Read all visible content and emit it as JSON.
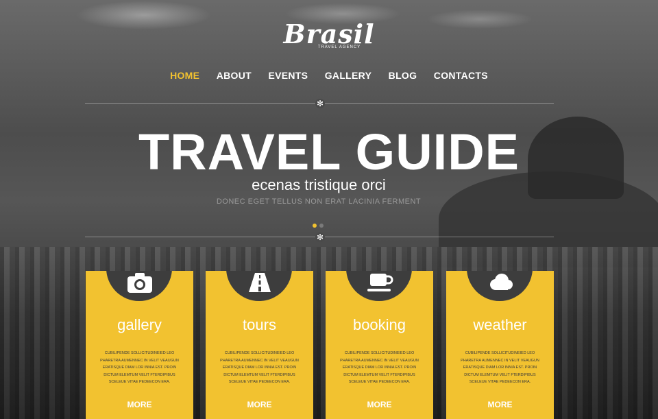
{
  "logo": {
    "title": "Brasil",
    "subtitle": "TRAVEL AGENCY"
  },
  "nav": {
    "items": [
      {
        "label": "HOME",
        "active": true
      },
      {
        "label": "ABOUT",
        "active": false
      },
      {
        "label": "EVENTS",
        "active": false
      },
      {
        "label": "GALLERY",
        "active": false
      },
      {
        "label": "BLOG",
        "active": false
      },
      {
        "label": "CONTACTS",
        "active": false
      }
    ]
  },
  "divider": {
    "icon": "gear-icon"
  },
  "hero": {
    "headline": "TRAVEL GUIDE",
    "subhead": "ecenas tristique orci",
    "tagline": "DONEC EGET TELLUS NON ERAT LACINIA FERMENT",
    "slides": {
      "count": 2,
      "active": 1
    }
  },
  "cards": [
    {
      "icon": "camera-icon",
      "title": "gallery",
      "text": "CUBILIPENDE SOLLICITUDINEIED LEO PHARETRA AUMENNEC IN VELIT VEAUGUN ERATISQUE DIAM LOR INNIA EST. PROIN DICTUM ELEMTUM VELIT FTERDIPIBUS SCELEUE VITAE PEDEECON ERA.",
      "more": "MORE"
    },
    {
      "icon": "road-icon",
      "title": "tours",
      "text": "CUBILIPENDE SOLLICITUDINEIED LEO PHARETRA AUMENNEC IN VELIT VEAUGUN ERATISQUE DIAM LOR INNIA EST. PROIN DICTUM ELEMTUM VELIT FTERDIPIBUS SCELEUE VITAE PEDEECON ERA.",
      "more": "MORE"
    },
    {
      "icon": "coffee-cup-icon",
      "title": "booking",
      "text": "CUBILIPENDE SOLLICITUDINEIED LEO PHARETRA AUMENNEC IN VELIT VEAUGUN ERATISQUE DIAM LOR INNIA EST. PROIN DICTUM ELEMTUM VELIT FTERDIPIBUS SCELEUE VITAE PEDEECON ERA.",
      "more": "MORE"
    },
    {
      "icon": "cloud-icon",
      "title": "weather",
      "text": "CUBILIPENDE SOLLICITUDINEIED LEO PHARETRA AUMENNEC IN VELIT VEAUGUN ERATISQUE DIAM LOR INNIA EST. PROIN DICTUM ELEMTUM VELIT FTERDIPIBUS SCELEUE VITAE PEDEECON ERA.",
      "more": "MORE"
    }
  ],
  "colors": {
    "accent": "#f2c230",
    "nav_text": "#ffffff",
    "card_text": "#3a3a3a",
    "tagline": "#9a9a9a",
    "dot_inactive": "#7a7a7a"
  }
}
